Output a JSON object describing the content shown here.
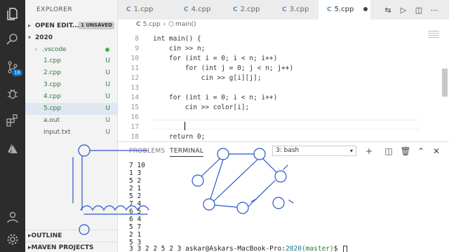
{
  "activity": {
    "badge_count": "16"
  },
  "sidebar": {
    "title": "EXPLORER",
    "open_editors": {
      "label": "OPEN EDIT...",
      "unsaved": "1 UNSAVED"
    },
    "folder": "2020",
    "files": [
      {
        "name": ".vscode",
        "status": ""
      },
      {
        "name": "1.cpp",
        "status": "U"
      },
      {
        "name": "2.cpp",
        "status": "U"
      },
      {
        "name": "3.cpp",
        "status": "U"
      },
      {
        "name": "4.cpp",
        "status": "U"
      },
      {
        "name": "5.cpp",
        "status": "U"
      },
      {
        "name": "a.out",
        "status": "U"
      },
      {
        "name": "input.txt",
        "status": "U"
      }
    ],
    "outline": "OUTLINE",
    "maven": "MAVEN PROJECTS"
  },
  "tabs": [
    {
      "label": "1.cpp"
    },
    {
      "label": "4.cpp"
    },
    {
      "label": "2.cpp"
    },
    {
      "label": "3.cpp"
    },
    {
      "label": "5.cpp"
    }
  ],
  "breadcrumb": {
    "file": "5.cpp",
    "symbol": "main()"
  },
  "code": [
    {
      "n": "8",
      "text": "int main() {"
    },
    {
      "n": "9",
      "text": "    cin >> n;"
    },
    {
      "n": "10",
      "text": "    for (int i = 0; i < n; i++)"
    },
    {
      "n": "11",
      "text": "        for (int j = 0; j < n; j++)"
    },
    {
      "n": "12",
      "text": "            cin >> g[i][j];"
    },
    {
      "n": "13",
      "text": ""
    },
    {
      "n": "14",
      "text": "    for (int i = 0; i < n; i++)"
    },
    {
      "n": "15",
      "text": "        cin >> color[i];"
    },
    {
      "n": "16",
      "text": ""
    },
    {
      "n": "17",
      "text": ""
    },
    {
      "n": "18",
      "text": "    return 0;"
    }
  ],
  "panel": {
    "tabs": [
      "PROBLEMS",
      "TERMINAL"
    ],
    "terminal_select": "3: bash",
    "terminal_lines": [
      "7 10",
      "1 3",
      "5 2",
      "2 1",
      "5 2",
      "7 4",
      "6 5",
      "6 4",
      "5 7",
      "2 1",
      "5 3"
    ],
    "prompt": {
      "prefix": "3 3 2 2 5 2 3 ",
      "user": "askar@Askars-MacBook-Pro:",
      "path": "2020",
      "branch": "(master)",
      "symbol": "$ "
    }
  },
  "colors": {
    "activity_bg": "#2c2c2c",
    "sidebar_bg": "#f3f3f3",
    "git_untracked": "#2a7a3a",
    "accent": "#0e70c0",
    "ink": "#2a55c7"
  }
}
